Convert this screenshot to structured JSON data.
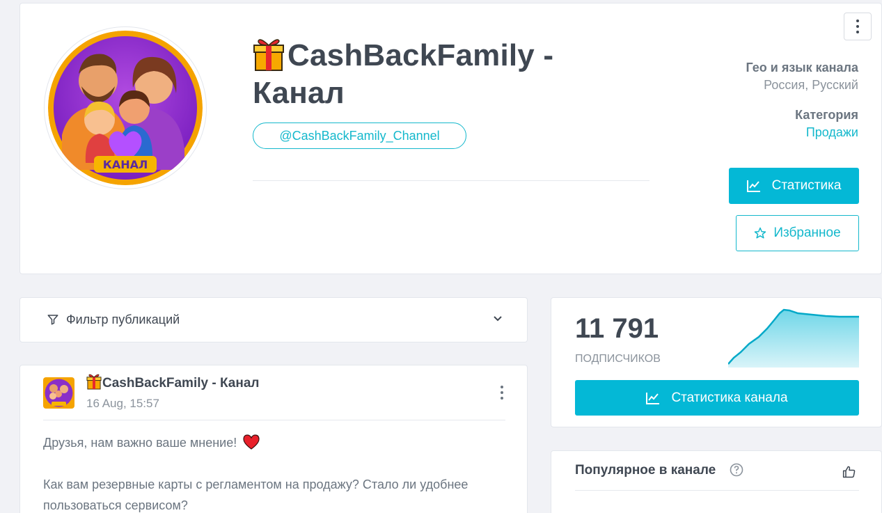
{
  "channel": {
    "title": "CashBackFamily - Канал",
    "handle": "@CashBackFamily_Channel",
    "avatar_badge": "КАНАЛ"
  },
  "meta": {
    "geo_label": "Гео и язык канала",
    "geo_value": "Россия, Русский",
    "category_label": "Категория",
    "category_value": "Продажи"
  },
  "buttons": {
    "stats": "Статистика",
    "favorite": "Избранное",
    "channel_stats": "Статистика канала"
  },
  "filter": {
    "label": "Фильтр публикаций"
  },
  "post": {
    "author": "CashBackFamily - Канал",
    "date": "16 Aug, 15:57",
    "line1": "Друзья, нам важно ваше мнение!",
    "line2": "Как вам резервные карты с регламентом на продажу? Стало ли удобнее пользоваться сервисом?"
  },
  "subscribers": {
    "count": "11 791",
    "label": "ПОДПИСЧИКОВ"
  },
  "popular": {
    "title": "Популярное в канале"
  },
  "icons": {
    "gift": "gift-icon",
    "heart": "heart-icon",
    "chart": "chart-line-icon",
    "star": "star-icon",
    "filter": "filter-icon",
    "chevron": "chevron-down-icon",
    "menu": "kebab-menu-icon",
    "help": "question-icon",
    "like": "thumbs-up-icon"
  },
  "colors": {
    "accent": "#04b8d6",
    "text": "#3f4752",
    "muted": "#8b939c",
    "background": "#f1f2f6"
  }
}
